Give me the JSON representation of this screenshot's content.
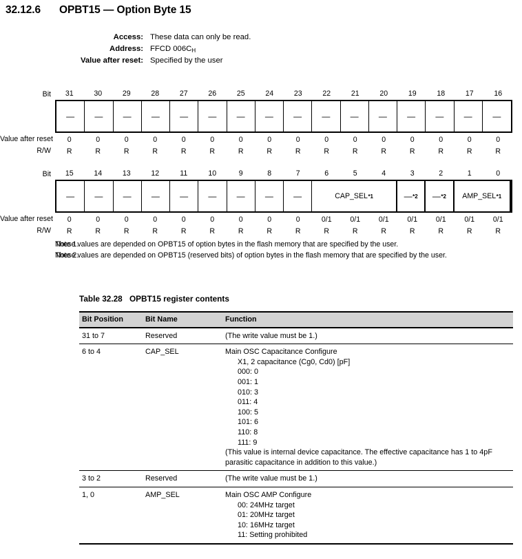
{
  "section": {
    "number": "32.12.6",
    "title": "OPBT15 — Option Byte 15"
  },
  "meta": [
    {
      "label": "Access:",
      "value": "These data can only be read.",
      "sub": ""
    },
    {
      "label": "Address:",
      "value": "FFCD 006C",
      "sub": "H"
    },
    {
      "label": "Value after reset:",
      "value": "Specified by the user",
      "sub": ""
    }
  ],
  "register_upper": {
    "bit_label": "Bit",
    "value_label": "Value after reset",
    "rw_label": "R/W",
    "bits": [
      "31",
      "30",
      "29",
      "28",
      "27",
      "26",
      "25",
      "24",
      "23",
      "22",
      "21",
      "20",
      "19",
      "18",
      "17",
      "16"
    ],
    "cells": [
      {
        "text": "—",
        "sup": "",
        "span": 1
      },
      {
        "text": "—",
        "sup": "",
        "span": 1
      },
      {
        "text": "—",
        "sup": "",
        "span": 1
      },
      {
        "text": "—",
        "sup": "",
        "span": 1
      },
      {
        "text": "—",
        "sup": "",
        "span": 1
      },
      {
        "text": "—",
        "sup": "",
        "span": 1
      },
      {
        "text": "—",
        "sup": "",
        "span": 1
      },
      {
        "text": "—",
        "sup": "",
        "span": 1
      },
      {
        "text": "—",
        "sup": "",
        "span": 1
      },
      {
        "text": "—",
        "sup": "",
        "span": 1
      },
      {
        "text": "—",
        "sup": "",
        "span": 1
      },
      {
        "text": "—",
        "sup": "",
        "span": 1
      },
      {
        "text": "—",
        "sup": "",
        "span": 1
      },
      {
        "text": "—",
        "sup": "",
        "span": 1
      },
      {
        "text": "—",
        "sup": "",
        "span": 1
      },
      {
        "text": "—",
        "sup": "",
        "span": 1
      }
    ],
    "reset_values": [
      "0",
      "0",
      "0",
      "0",
      "0",
      "0",
      "0",
      "0",
      "0",
      "0",
      "0",
      "0",
      "0",
      "0",
      "0",
      "0"
    ],
    "rw_values": [
      "R",
      "R",
      "R",
      "R",
      "R",
      "R",
      "R",
      "R",
      "R",
      "R",
      "R",
      "R",
      "R",
      "R",
      "R",
      "R"
    ]
  },
  "register_lower": {
    "bit_label": "Bit",
    "value_label": "Value after reset",
    "rw_label": "R/W",
    "bits": [
      "15",
      "14",
      "13",
      "12",
      "11",
      "10",
      "9",
      "8",
      "7",
      "6",
      "5",
      "4",
      "3",
      "2",
      "1",
      "0"
    ],
    "cells": [
      {
        "text": "—",
        "sup": "",
        "span": 1
      },
      {
        "text": "—",
        "sup": "",
        "span": 1
      },
      {
        "text": "—",
        "sup": "",
        "span": 1
      },
      {
        "text": "—",
        "sup": "",
        "span": 1
      },
      {
        "text": "—",
        "sup": "",
        "span": 1
      },
      {
        "text": "—",
        "sup": "",
        "span": 1
      },
      {
        "text": "—",
        "sup": "",
        "span": 1
      },
      {
        "text": "—",
        "sup": "",
        "span": 1
      },
      {
        "text": "—",
        "sup": "",
        "span": 1
      },
      {
        "text": "CAP_SEL",
        "sup": "*1",
        "span": 3
      },
      {
        "text": "—",
        "sup": "*2",
        "span": 1
      },
      {
        "text": "—",
        "sup": "*2",
        "span": 1
      },
      {
        "text": "AMP_SEL",
        "sup": "*1",
        "span": 2
      }
    ],
    "reset_values": [
      "0",
      "0",
      "0",
      "0",
      "0",
      "0",
      "0",
      "0",
      "0",
      "0/1",
      "0/1",
      "0/1",
      "0/1",
      "0/1",
      "0/1",
      "0/1"
    ],
    "rw_values": [
      "R",
      "R",
      "R",
      "R",
      "R",
      "R",
      "R",
      "R",
      "R",
      "R",
      "R",
      "R",
      "R",
      "R",
      "R",
      "R"
    ]
  },
  "notes": [
    {
      "label": "Note 1.",
      "text": "These values are depended on OPBT15 of option bytes in the flash memory that are specified by the user."
    },
    {
      "label": "Note 2.",
      "text": "These values are depended on OPBT15 (reserved bits) of option bytes in the flash memory that are specified by the user."
    }
  ],
  "table": {
    "caption_number": "Table 32.28",
    "caption_title": "OPBT15 register contents",
    "headers": [
      "Bit Position",
      "Bit Name",
      "Function"
    ],
    "rows": [
      {
        "position": "31 to 7",
        "name": "Reserved",
        "function_lines": [
          {
            "text": "(The write value must be 1.)",
            "indent": false
          }
        ]
      },
      {
        "position": "6 to 4",
        "name": "CAP_SEL",
        "function_lines": [
          {
            "text": "Main OSC Capacitance Configure",
            "indent": false
          },
          {
            "text": "X1, 2 capacitance (Cg0, Cd0) [pF]",
            "indent": true
          },
          {
            "text": "000: 0",
            "indent": true
          },
          {
            "text": "001: 1",
            "indent": true
          },
          {
            "text": "010: 3",
            "indent": true
          },
          {
            "text": "011: 4",
            "indent": true
          },
          {
            "text": "100: 5",
            "indent": true
          },
          {
            "text": "101: 6",
            "indent": true
          },
          {
            "text": "110: 8",
            "indent": true
          },
          {
            "text": "111: 9",
            "indent": true
          },
          {
            "text": "(This value is internal device capacitance. The effective capacitance has 1 to 4pF parasitic capacitance in addition to this value.)",
            "indent": false
          }
        ]
      },
      {
        "position": "3 to 2",
        "name": "Reserved",
        "function_lines": [
          {
            "text": "(The write value must be 1.)",
            "indent": false
          }
        ]
      },
      {
        "position": "1, 0",
        "name": "AMP_SEL",
        "function_lines": [
          {
            "text": "Main OSC AMP Configure",
            "indent": false
          },
          {
            "text": "00: 24MHz target",
            "indent": true
          },
          {
            "text": "01: 20MHz target",
            "indent": true
          },
          {
            "text": "10: 16MHz target",
            "indent": true
          },
          {
            "text": "11: Setting prohibited",
            "indent": true
          }
        ]
      }
    ]
  }
}
